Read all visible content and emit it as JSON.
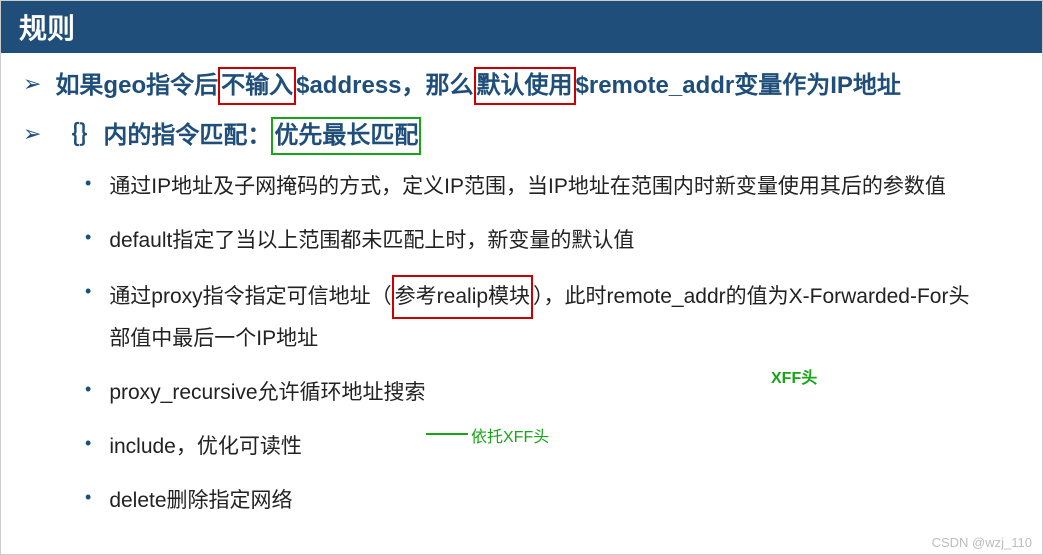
{
  "header": {
    "title": "规则"
  },
  "maj1": {
    "pre": "如果geo指令后",
    "box1": "不输入",
    "mid": "$address，那么",
    "box2": "默认使用",
    "post": "$remote_addr变量作为IP地址"
  },
  "maj2": {
    "pre": "｛｝内的指令匹配：",
    "box": "优先最长匹配"
  },
  "sub1": "通过IP地址及子网掩码的方式，定义IP范围，当IP地址在范围内时新变量使用其后的参数值",
  "sub2": "default指定了当以上范围都未匹配上时，新变量的默认值",
  "sub3": {
    "pre": "通过proxy指令指定可信地址（",
    "box": "参考realip模块",
    "post": "），此时remote_addr的值为X-Forwarded-For头部值中最后一个IP地址"
  },
  "sub4": "proxy_recursive允许循环地址搜索",
  "sub5": "include，优化可读性",
  "sub6": "delete删除指定网络",
  "annotations": {
    "xff_header": "XFF头",
    "xff_depend": "依托XFF头"
  },
  "watermark": "CSDN @wzj_110",
  "markers": {
    "major": "➢",
    "minor": "•"
  }
}
